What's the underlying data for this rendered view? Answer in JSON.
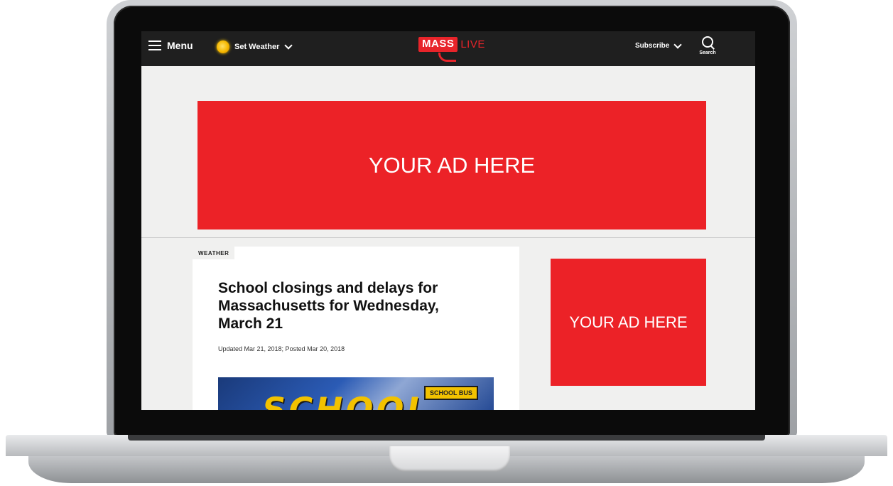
{
  "header": {
    "menu_label": "Menu",
    "weather_label": "Set Weather",
    "logo_primary": "MASS",
    "logo_secondary": "LIVE",
    "subscribe_label": "Subscribe",
    "search_label": "Search"
  },
  "ads": {
    "banner_text": "YOUR AD HERE",
    "square_text": "YOUR AD HERE"
  },
  "article": {
    "category": "WEATHER",
    "headline": "School closings and delays for Massachusetts for Wednesday, March 21",
    "dates": "Updated Mar 21, 2018; Posted Mar 20, 2018",
    "image_words": [
      "SCHOOL",
      "SCHOOL BUS"
    ]
  },
  "colors": {
    "brand_red": "#ec2227",
    "header_bg": "#1f1f1f",
    "page_bg": "#f0f0ef"
  }
}
